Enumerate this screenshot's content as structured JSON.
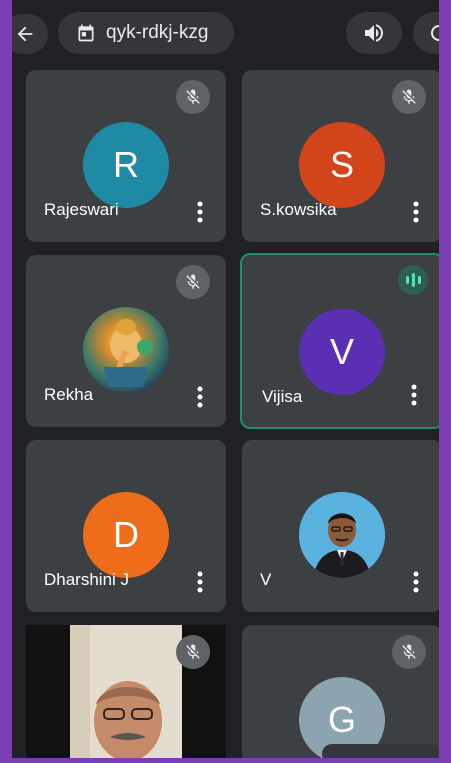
{
  "meeting": {
    "code": "qyk-rdkj-kzg"
  },
  "icons": {
    "back": "back-arrow-icon",
    "calendar": "calendar-icon",
    "speaker": "speaker-icon",
    "switch_camera": "switch-camera-icon",
    "mic_off": "mic-off-icon",
    "more": "more-vert-icon",
    "speaking": "audio-level-icon"
  },
  "colors": {
    "frame_border": "#7b3fb3",
    "background": "#202124",
    "tile": "#3c4043",
    "speaking_border": "#1e8e6e",
    "speaking_indicator": "#4fe3b0"
  },
  "participants": [
    {
      "name": "Rajeswari",
      "initial": "R",
      "avatar_color": "#1f8aa4",
      "muted": true
    },
    {
      "name": "S.kowsika",
      "initial": "S",
      "avatar_color": "#d2441a",
      "muted": true
    },
    {
      "name": "Rekha",
      "initial": "",
      "avatar_type": "photo",
      "muted": true
    },
    {
      "name": "Vijisa",
      "initial": "V",
      "avatar_color": "#5b2fb4",
      "muted": false,
      "speaking": true
    },
    {
      "name": "Dharshini J",
      "initial": "D",
      "avatar_color": "#ef6c1a",
      "muted": false
    },
    {
      "name": "V",
      "initial": "",
      "avatar_type": "photo",
      "muted": false
    },
    {
      "name": "",
      "initial": "",
      "avatar_type": "video",
      "muted": true
    },
    {
      "name": "",
      "initial": "G",
      "avatar_color": "#8ca3b0",
      "muted": true
    }
  ]
}
